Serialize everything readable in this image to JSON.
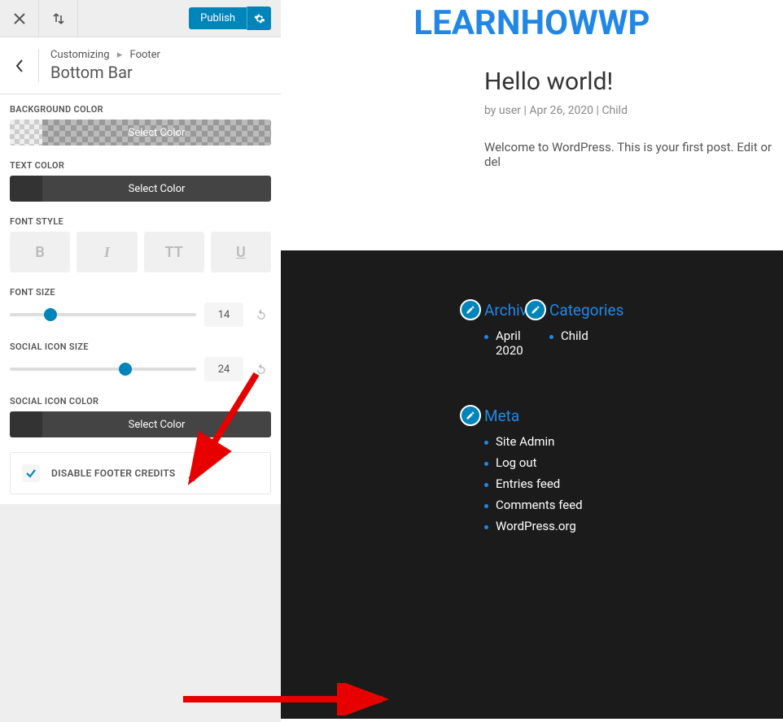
{
  "topbar": {
    "publish_label": "Publish"
  },
  "header": {
    "breadcrumb_root": "Customizing",
    "breadcrumb_parent": "Footer",
    "title": "Bottom Bar"
  },
  "controls": {
    "background_color": {
      "label": "BACKGROUND COLOR",
      "button": "Select Color"
    },
    "text_color": {
      "label": "TEXT COLOR",
      "button": "Select Color"
    },
    "font_style": {
      "label": "FONT STYLE",
      "bold": "B",
      "italic": "I",
      "caps": "TT",
      "underline": "U"
    },
    "font_size": {
      "label": "FONT SIZE",
      "value": "14"
    },
    "social_icon_size": {
      "label": "SOCIAL ICON SIZE",
      "value": "24"
    },
    "social_icon_color": {
      "label": "SOCIAL ICON COLOR",
      "button": "Select Color"
    },
    "disable_credits": {
      "label": "DISABLE FOOTER CREDITS",
      "checked": true
    }
  },
  "preview": {
    "site_title": "LEARNHOWWP",
    "post": {
      "title": "Hello world!",
      "meta_by": "by",
      "meta_author": "user",
      "meta_date": "Apr 26, 2020",
      "meta_category": "Child",
      "body": "Welcome to WordPress. This is your first post. Edit or del"
    },
    "footer": {
      "archives": {
        "title": "Archives",
        "items": [
          "April 2020"
        ]
      },
      "categories": {
        "title": "Categories",
        "items": [
          "Child"
        ]
      },
      "meta": {
        "title": "Meta",
        "items": [
          "Site Admin",
          "Log out",
          "Entries feed",
          "Comments feed",
          "WordPress.org"
        ]
      }
    }
  }
}
